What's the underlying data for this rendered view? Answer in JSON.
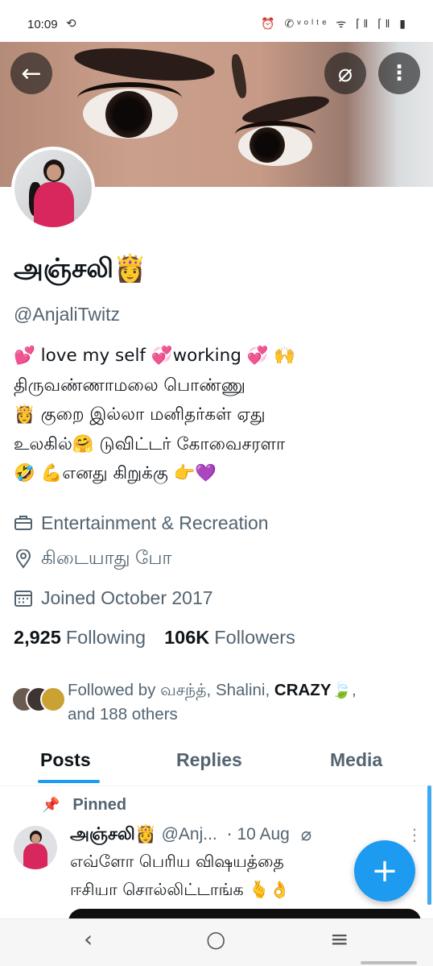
{
  "status_bar": {
    "time": "10:09",
    "sync_icon": "sync-icon",
    "right_icons": [
      "alarm-icon",
      "volte-call-icon",
      "wifi-icon",
      "signal-icon",
      "signal-icon",
      "battery-icon"
    ],
    "right_text": "⏰ ✆ᵛᵒˡᵗᵉ ᯤ ⌈‖ ⌈‖ ▮"
  },
  "header": {
    "back_icon": "arrow-left-icon",
    "hide_icon": "grok-slash-icon",
    "more_icon": "more-vertical-icon"
  },
  "profile": {
    "name": "அஞ்சலி👸",
    "handle": "@AnjaliTwitz",
    "bio_lines": [
      "💕 love my self 💞working 💞 🙌",
      "திருவண்ணாமலை பொண்ணு",
      "👸 குறை இல்லா மனிதர்கள் ஏது",
      "உலகில்🤗 டுவிட்டர் கோவைசரளா",
      "🤣 💪எனது கிறுக்கு 👉💜"
    ],
    "category": "Entertainment & Recreation",
    "location": "கிடையாது போ",
    "joined": "Joined October 2017",
    "following_count": "2,925",
    "following_label": "Following",
    "followers_count": "106K",
    "followers_label": "Followers",
    "followed_by_prefix": "Followed by வசந்த், Shalini, ",
    "followed_by_bold": "CRAZY",
    "followed_by_suffix": "🍃,",
    "followed_by_line2": "and 188 others"
  },
  "tabs": [
    {
      "label": "Posts",
      "active": true
    },
    {
      "label": "Replies",
      "active": false
    },
    {
      "label": "Media",
      "active": false
    }
  ],
  "post": {
    "pinned_label": "Pinned",
    "author": "அஞ்சலி👸",
    "handle": "@Anj...",
    "dot": "·",
    "date": "10 Aug",
    "text_lines": [
      "எவ்ளோ பெரிய விஷயத்தை",
      "ஈசியா சொல்லிட்டாங்க 🫰👌"
    ]
  },
  "fab": {
    "label": "+"
  },
  "nav": {
    "back": "‹",
    "home": "○",
    "recents": "≡"
  },
  "colors": {
    "accent": "#1d9bf0",
    "text": "#0f1419",
    "muted": "#536471"
  }
}
